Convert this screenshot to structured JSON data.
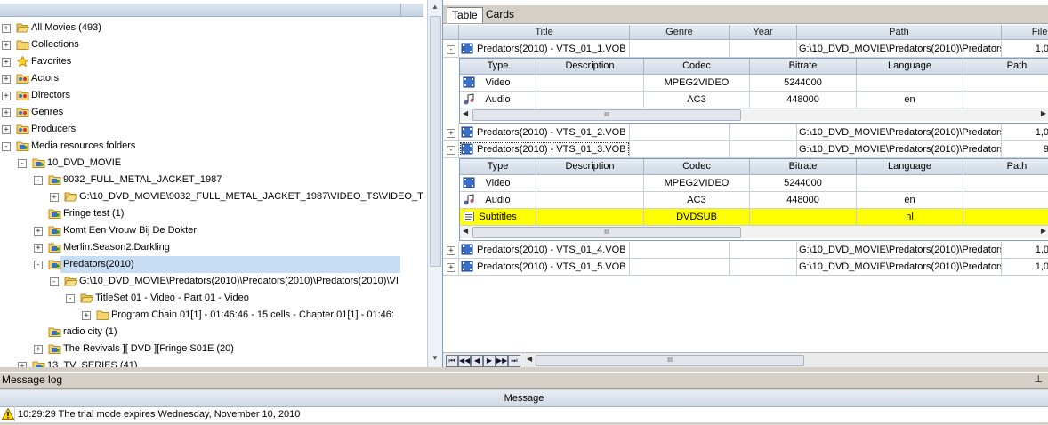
{
  "tree": {
    "items": [
      {
        "label": "All Movies (493)",
        "icon": "folder-open-icon"
      },
      {
        "label": "Collections",
        "icon": "folder-icon"
      },
      {
        "label": "Favorites",
        "icon": "star-icon"
      },
      {
        "label": "Actors",
        "icon": "people-folder-icon"
      },
      {
        "label": "Directors",
        "icon": "people-folder-icon"
      },
      {
        "label": "Genres",
        "icon": "people-folder-icon"
      },
      {
        "label": "Producers",
        "icon": "people-folder-icon"
      },
      {
        "label": "Media resources folders",
        "icon": "media-folder-icon"
      },
      {
        "label": "10_DVD_MOVIE",
        "icon": "media-folder-icon"
      },
      {
        "label": "9032_FULL_METAL_JACKET_1987",
        "icon": "media-folder-icon"
      },
      {
        "label": "G:\\10_DVD_MOVIE\\9032_FULL_METAL_JACKET_1987\\VIDEO_TS\\VIDEO_T",
        "icon": "folder-open-icon"
      },
      {
        "label": "Fringe test (1)",
        "icon": "media-folder-icon"
      },
      {
        "label": "Komt Een Vrouw Bij De Dokter",
        "icon": "media-folder-icon"
      },
      {
        "label": "Merlin.Season2.Darkling",
        "icon": "media-folder-icon"
      },
      {
        "label": "Predators(2010)",
        "icon": "media-folder-icon"
      },
      {
        "label": "G:\\10_DVD_MOVIE\\Predators(2010)\\Predators(2010)\\Predators(2010)\\VI",
        "icon": "folder-open-icon"
      },
      {
        "label": "TitleSet 01 - Video - Part 01 - Video",
        "icon": "folder-open-icon"
      },
      {
        "label": "Program Chain 01[1] - 01:46:46 - 15 cells - Chapter 01[1] - 01:46:",
        "icon": "folder-icon"
      },
      {
        "label": "radio city (1)",
        "icon": "media-folder-icon"
      },
      {
        "label": "The Revivals ][ DVD ][Fringe S01E (20)",
        "icon": "media-folder-icon"
      },
      {
        "label": "13_TV_SERIES (41)",
        "icon": "media-folder-icon"
      }
    ]
  },
  "tabs": [
    {
      "label": "Table"
    },
    {
      "label": "Cards"
    }
  ],
  "grid": {
    "columns": [
      "Title",
      "Genre",
      "Year",
      "Path",
      "File s"
    ],
    "rows": [
      {
        "title": "Predators(2010) - VTS_01_1.VOB",
        "path": "G:\\10_DVD_MOVIE\\Predators(2010)\\Predators(",
        "size": "1,0"
      },
      {
        "title": "Predators(2010) - VTS_01_2.VOB",
        "path": "G:\\10_DVD_MOVIE\\Predators(2010)\\Predators(",
        "size": "1,0"
      },
      {
        "title": "Predators(2010) - VTS_01_3.VOB",
        "path": "G:\\10_DVD_MOVIE\\Predators(2010)\\Predators(",
        "size": "9"
      },
      {
        "title": "Predators(2010) - VTS_01_4.VOB",
        "path": "G:\\10_DVD_MOVIE\\Predators(2010)\\Predators(",
        "size": "1,0"
      },
      {
        "title": "Predators(2010) - VTS_01_5.VOB",
        "path": "G:\\10_DVD_MOVIE\\Predators(2010)\\Predators(",
        "size": "1,0"
      }
    ]
  },
  "subgrid": {
    "columns": [
      "Type",
      "Description",
      "Codec",
      "Bitrate",
      "Language",
      "Path"
    ],
    "detail1": [
      {
        "type": "Video",
        "codec": "MPEG2VIDEO",
        "bitrate": "5244000",
        "language": ""
      },
      {
        "type": "Audio",
        "codec": "AC3",
        "bitrate": "448000",
        "language": "en"
      }
    ],
    "detail3": [
      {
        "type": "Video",
        "codec": "MPEG2VIDEO",
        "bitrate": "5244000",
        "language": ""
      },
      {
        "type": "Audio",
        "codec": "AC3",
        "bitrate": "448000",
        "language": "en"
      },
      {
        "type": "Subtitles",
        "codec": "DVDSUB",
        "bitrate": "",
        "language": "nl"
      }
    ],
    "scroll_grip": "III"
  },
  "message_log": {
    "title": "Message log",
    "column": "Message",
    "entries": [
      {
        "text": "10:29:29 The trial mode expires Wednesday, November 10, 2010"
      }
    ],
    "pin_glyph": "⊥"
  },
  "colors": {
    "highlight_row": "#ffff00",
    "selection": "#c7ddf4"
  }
}
